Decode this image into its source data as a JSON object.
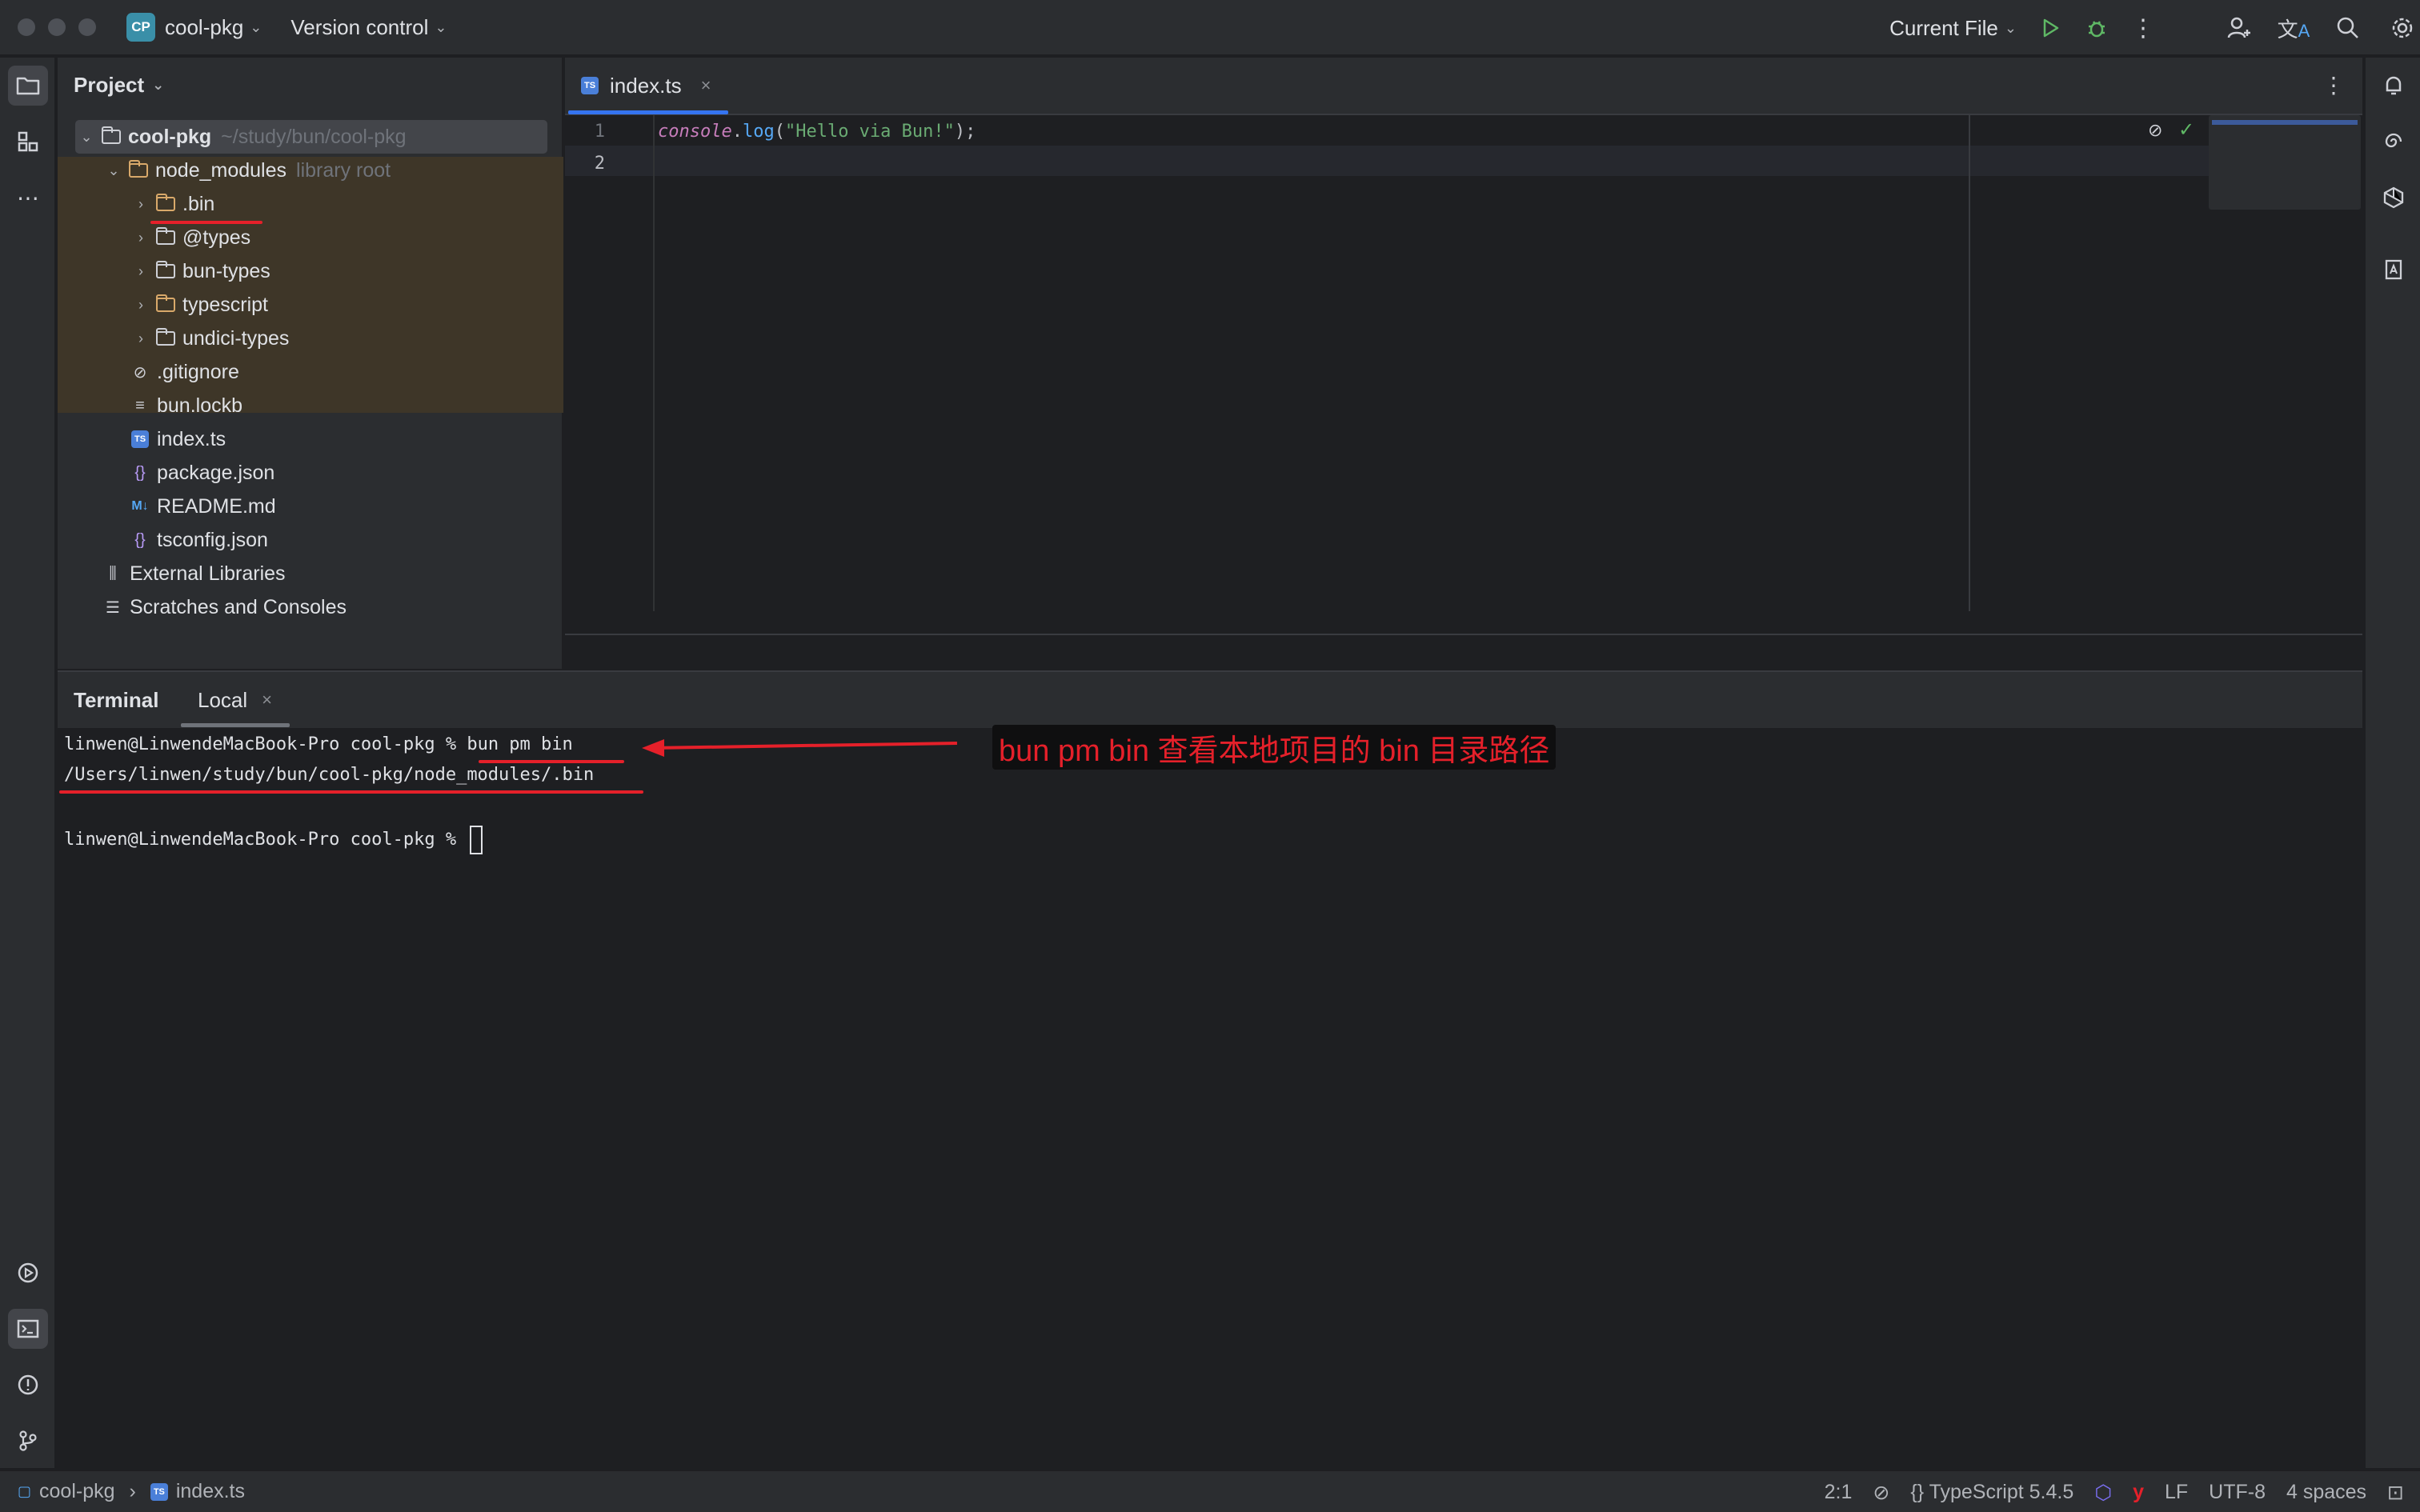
{
  "titlebar": {
    "project_badge": "CP",
    "project_name": "cool-pkg",
    "vcs_label": "Version control",
    "run_config": "Current File"
  },
  "project_panel": {
    "title": "Project",
    "root": {
      "name": "cool-pkg",
      "path": "~/study/bun/cool-pkg"
    },
    "node_modules": {
      "name": "node_modules",
      "hint": "library root"
    },
    "folders": [
      ".bin",
      "@types",
      "bun-types",
      "typescript",
      "undici-types"
    ],
    "files": [
      ".gitignore",
      "bun.lockb",
      "index.ts",
      "package.json",
      "README.md",
      "tsconfig.json"
    ],
    "extra": [
      "External Libraries",
      "Scratches and Consoles"
    ]
  },
  "editor": {
    "tab_label": "index.ts",
    "line_numbers": [
      "1",
      "2"
    ],
    "code": {
      "obj": "console",
      "dot": ".",
      "method": "log",
      "open": "(",
      "string": "\"Hello via Bun!\"",
      "close": ");"
    }
  },
  "terminal": {
    "title": "Terminal",
    "tab_label": "Local",
    "prompt": "linwen@LinwendeMacBook-Pro cool-pkg % ",
    "command": "bun pm bin",
    "output": "/Users/linwen/study/bun/cool-pkg/node_modules/.bin",
    "prompt2": "linwen@LinwendeMacBook-Pro cool-pkg % ",
    "annotation": "bun pm bin 查看本地项目的 bin 目录路径"
  },
  "statusbar": {
    "crumb_project": "cool-pkg",
    "crumb_file": "index.ts",
    "position": "2:1",
    "language": "TypeScript 5.4.5",
    "line_sep": "LF",
    "encoding": "UTF-8",
    "indent": "4 spaces"
  },
  "colors": {
    "accent": "#3574f0",
    "annotation_red": "#e5202a",
    "library_bg": "#3e3628"
  }
}
